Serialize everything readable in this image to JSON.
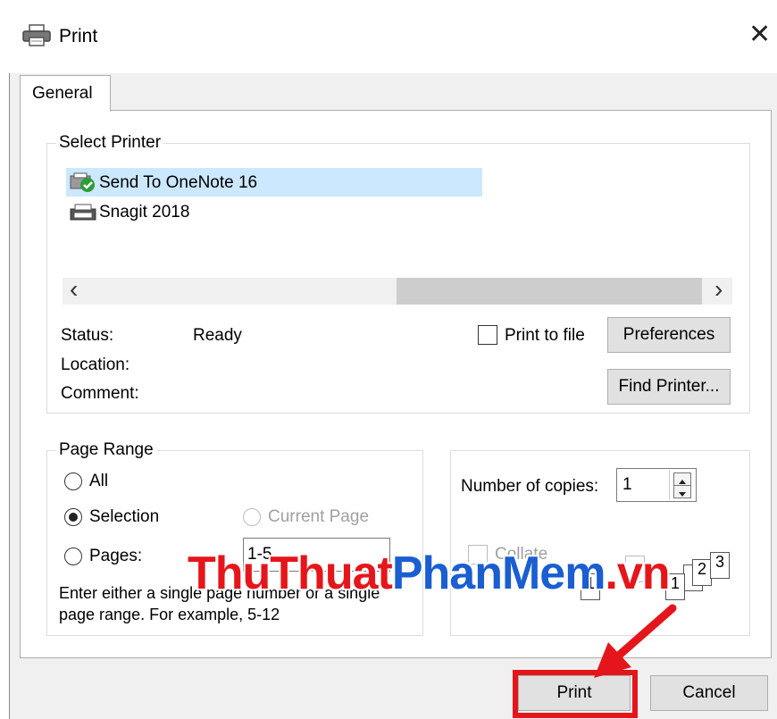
{
  "window": {
    "title": "Print",
    "close_icon": "close-icon",
    "printer_icon": "printer-icon"
  },
  "tabs": [
    {
      "label": "General"
    }
  ],
  "select_printer": {
    "legend": "Select Printer",
    "printers": [
      {
        "name": "Send To OneNote 16",
        "icon": "onenote-printer-icon",
        "selected": true
      },
      {
        "name": "Snagit 2018",
        "icon": "printer-icon",
        "selected": false
      }
    ],
    "scroll_left_glyph": "‹",
    "scroll_right_glyph": "›",
    "status_label": "Status:",
    "status_value": "Ready",
    "location_label": "Location:",
    "comment_label": "Comment:",
    "print_to_file_label": "Print to file",
    "print_to_file_checked": false,
    "preferences_label": "Preferences",
    "find_printer_label": "Find Printer..."
  },
  "page_range": {
    "legend": "Page Range",
    "all_label": "All",
    "selection_label": "Selection",
    "current_page_label": "Current Page",
    "pages_label": "Pages:",
    "pages_value": "1-5",
    "selected": "selection",
    "help_text_line1": "Enter either a single page number or a single",
    "help_text_line2": "page range.  For example, 5-12"
  },
  "copies": {
    "label": "Number of copies:",
    "value": "1",
    "collate_label": "Collate",
    "collate_pages": [
      "1",
      "2",
      "3"
    ]
  },
  "watermark": {
    "part1": "ThuThuat",
    "part2": "PhanMem",
    "part3": ".vn",
    "color_red": "#e5161b",
    "color_blue": "#1a5ed1"
  },
  "annotation": {
    "highlight_color": "#e5161b"
  },
  "buttons": {
    "print_label": "Print",
    "cancel_label": "Cancel"
  }
}
